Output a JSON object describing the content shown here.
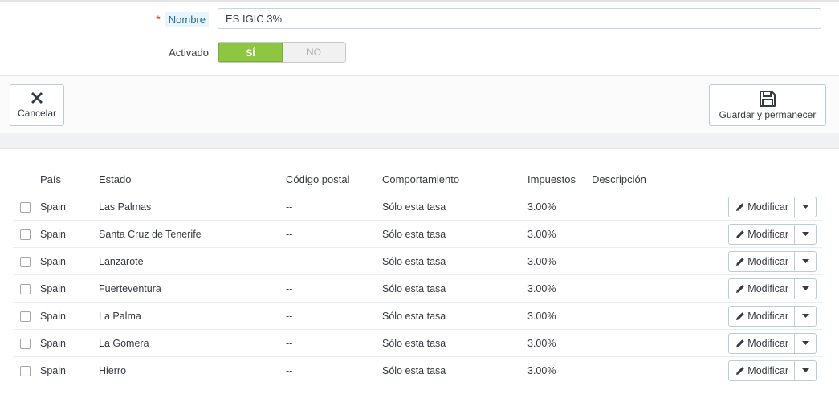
{
  "form": {
    "name_label": "Nombre",
    "required_mark": "*",
    "name_value": "ES IGIC 3%",
    "activated_label": "Activado",
    "toggle_yes": "SÍ",
    "toggle_no": "NO"
  },
  "footer": {
    "cancel_label": "Cancelar",
    "save_label": "Guardar y permanecer"
  },
  "table": {
    "headers": [
      "País",
      "Estado",
      "Código postal",
      "Comportamiento",
      "Impuestos",
      "Descripción"
    ],
    "rows": [
      {
        "country": "Spain",
        "state": "Las Palmas",
        "zip": "--",
        "behavior": "Sólo esta tasa",
        "tax": "3.00%",
        "description": ""
      },
      {
        "country": "Spain",
        "state": "Santa Cruz de Tenerife",
        "zip": "--",
        "behavior": "Sólo esta tasa",
        "tax": "3.00%",
        "description": ""
      },
      {
        "country": "Spain",
        "state": "Lanzarote",
        "zip": "--",
        "behavior": "Sólo esta tasa",
        "tax": "3.00%",
        "description": ""
      },
      {
        "country": "Spain",
        "state": "Fuerteventura",
        "zip": "--",
        "behavior": "Sólo esta tasa",
        "tax": "3.00%",
        "description": ""
      },
      {
        "country": "Spain",
        "state": "La Palma",
        "zip": "--",
        "behavior": "Sólo esta tasa",
        "tax": "3.00%",
        "description": ""
      },
      {
        "country": "Spain",
        "state": "La Gomera",
        "zip": "--",
        "behavior": "Sólo esta tasa",
        "tax": "3.00%",
        "description": ""
      },
      {
        "country": "Spain",
        "state": "Hierro",
        "zip": "--",
        "behavior": "Sólo esta tasa",
        "tax": "3.00%",
        "description": ""
      }
    ],
    "edit_label": "Modificar"
  },
  "colors": {
    "toggle_on": "#8ec641",
    "required": "#e0222d",
    "header_border": "#a0d0eb"
  }
}
